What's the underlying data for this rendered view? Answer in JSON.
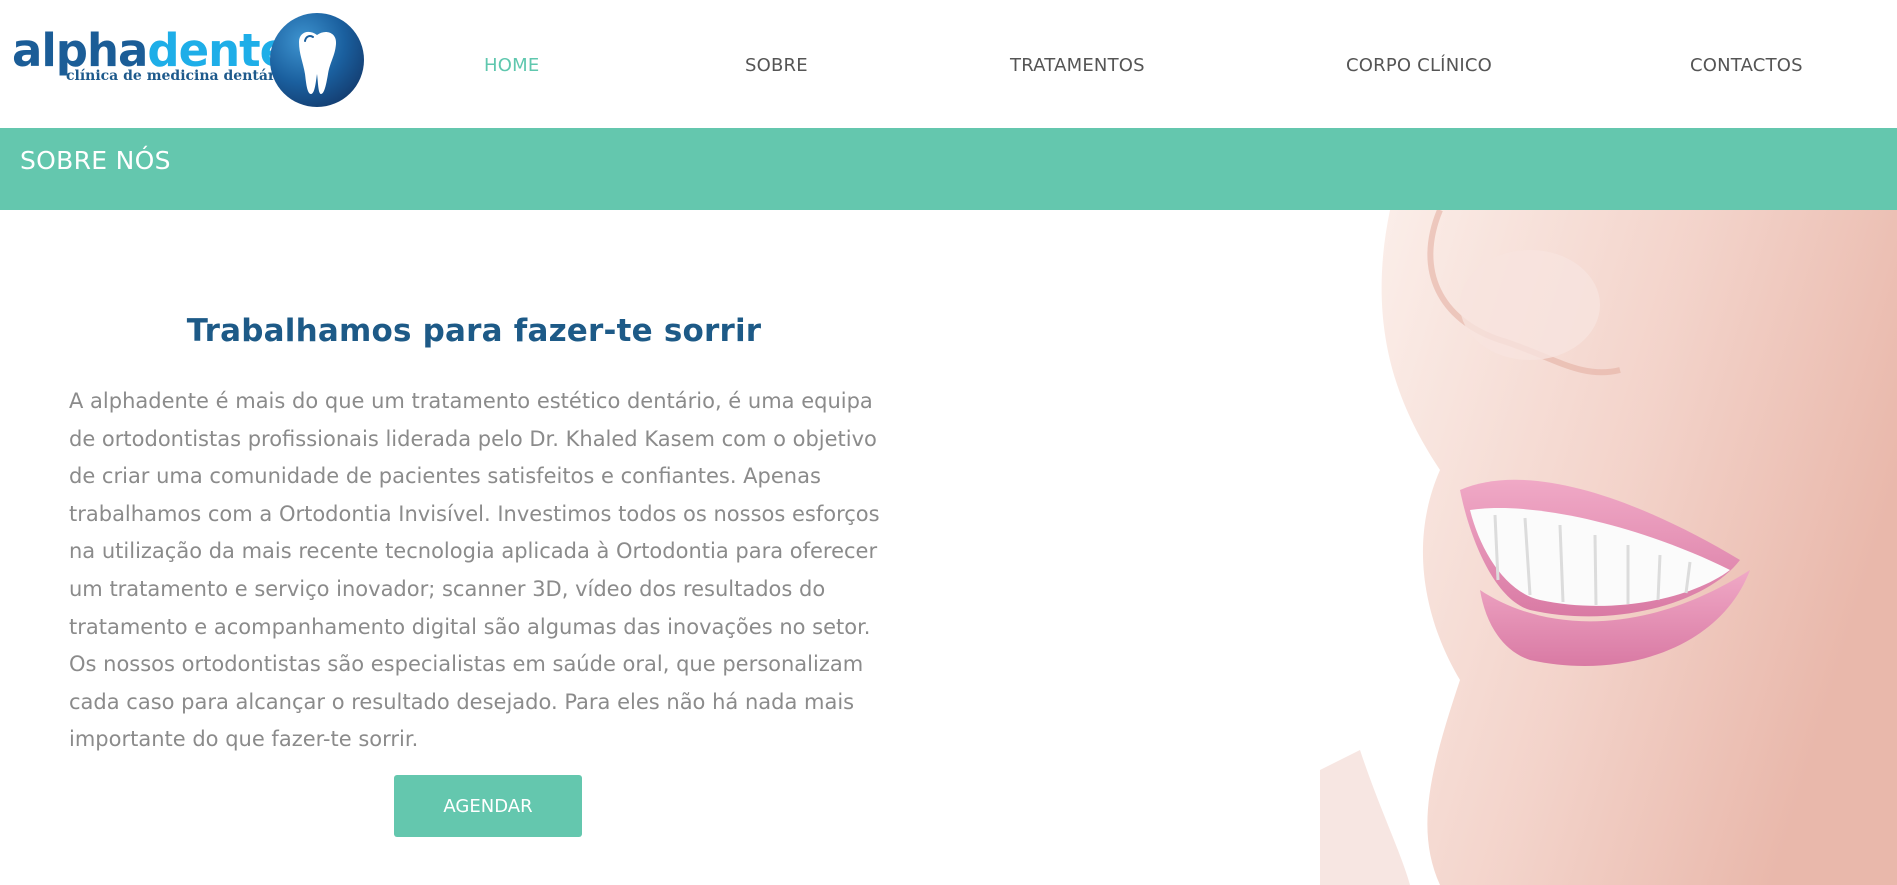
{
  "logo": {
    "word_a": "alpha",
    "word_b": "dente",
    "tagline": "clínica de medicina dentária",
    "icon": "tooth-icon"
  },
  "nav": [
    {
      "label": "HOME",
      "active": true
    },
    {
      "label": "SOBRE",
      "active": false
    },
    {
      "label": "TRATAMENTOS",
      "active": false
    },
    {
      "label": "CORPO CLÍNICO",
      "active": false
    },
    {
      "label": "CONTACTOS",
      "active": false
    }
  ],
  "banner": {
    "title": "SOBRE NÓS"
  },
  "main": {
    "heading": "Trabalhamos para fazer-te sorrir",
    "paragraph_lines": [
      "A alphadente é mais do que um tratamento estético dentário, é uma equipa",
      "de ortodontistas profissionais liderada pelo Dr. Khaled Kasem com o objetivo",
      "de criar uma comunidade de pacientes satisfeitos e confiantes. Apenas",
      "trabalhamos com a Ortodontia Invisível. Investimos todos os nossos esforços",
      "na utilização da mais recente tecnologia aplicada à Ortodontia para oferecer",
      "um tratamento e serviço inovador; scanner 3D, vídeo dos resultados do",
      "tratamento e acompanhamento digital são algumas das inovações no setor.",
      "Os nossos ortodontistas são especialistas em saúde oral, que personalizam",
      "cada caso para alcançar o resultado desejado. Para eles não há nada mais",
      "importante do que fazer-te sorrir."
    ],
    "button_label": "AGENDAR"
  },
  "colors": {
    "accent": "#64c7ae",
    "brand_dark": "#1b5d97",
    "brand_light": "#1eaee8",
    "heading": "#1d5a87",
    "body_text": "#8b8b8b",
    "nav_text": "#555555"
  }
}
